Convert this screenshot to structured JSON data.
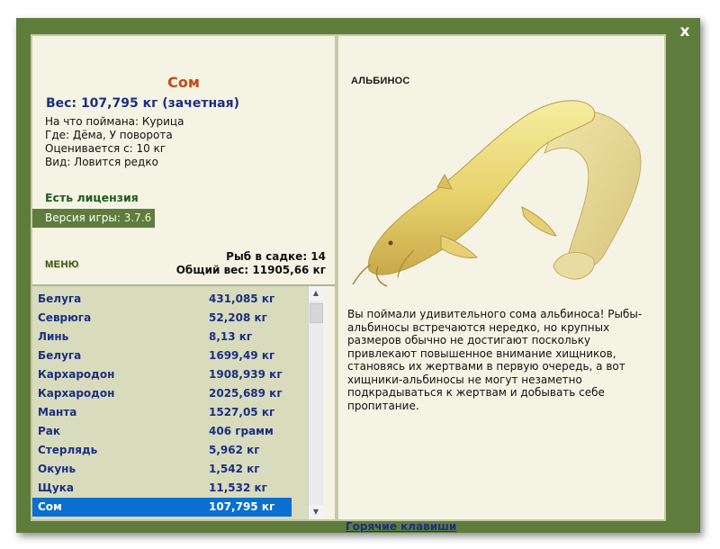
{
  "window": {
    "close_label": "x"
  },
  "fish": {
    "name": "Сом",
    "weight_line": "Вес: 107,795 кг (зачетная)",
    "bait": "На что поймана: Курица",
    "location": "Где: Дёма, У поворота",
    "evaluated_from": "Оценивается с: 10 кг",
    "rarity": "Вид: Ловится редко"
  },
  "license_text": "Есть лицензия",
  "version": {
    "label": "Версия игры:",
    "number": "3.7.6"
  },
  "menu_label": "МЕНЮ",
  "keep_net": {
    "count_text": "Рыб в садке: 14",
    "total_weight_text": "Общий вес: 11905,66 кг"
  },
  "catch_list": [
    {
      "name": "Белуга",
      "weight": "431,085 кг",
      "selected": false
    },
    {
      "name": "Севрюга",
      "weight": "52,208 кг",
      "selected": false
    },
    {
      "name": "Линь",
      "weight": "8,13 кг",
      "selected": false
    },
    {
      "name": "Белуга",
      "weight": "1699,49 кг",
      "selected": false
    },
    {
      "name": "Кархародон",
      "weight": "1908,939 кг",
      "selected": false
    },
    {
      "name": "Кархародон",
      "weight": "2025,689 кг",
      "selected": false
    },
    {
      "name": "Манта",
      "weight": "1527,05 кг",
      "selected": false
    },
    {
      "name": "Рак",
      "weight": "406 грамм",
      "selected": false
    },
    {
      "name": "Стерлядь",
      "weight": "5,962 кг",
      "selected": false
    },
    {
      "name": "Окунь",
      "weight": "1,542 кг",
      "selected": false
    },
    {
      "name": "Щука",
      "weight": "11,532 кг",
      "selected": false
    },
    {
      "name": "Сом",
      "weight": "107,795 кг",
      "selected": true
    }
  ],
  "detail": {
    "label": "АЛЬБИНОС",
    "description": "Вы поймали удивительного сома альбиноса! Рыбы-альбиносы встречаются нередко, но крупных размеров обычно не достигают поскольку привлекают повышенное внимание хищников, становясь их жертвами в первую очередь, а вот хищники-альбиносы не могут незаметно подкрадываться к жертвам и добывать себе пропитание.",
    "hotkeys_link": "Горячие клавиши"
  },
  "colors": {
    "frame": "#5e7d3d",
    "panel": "#f5f4e4",
    "list_bg": "#d8dcbd",
    "selection": "#0a6fd0",
    "title_orange": "#c84a14",
    "text_blue": "#1c2f82"
  }
}
